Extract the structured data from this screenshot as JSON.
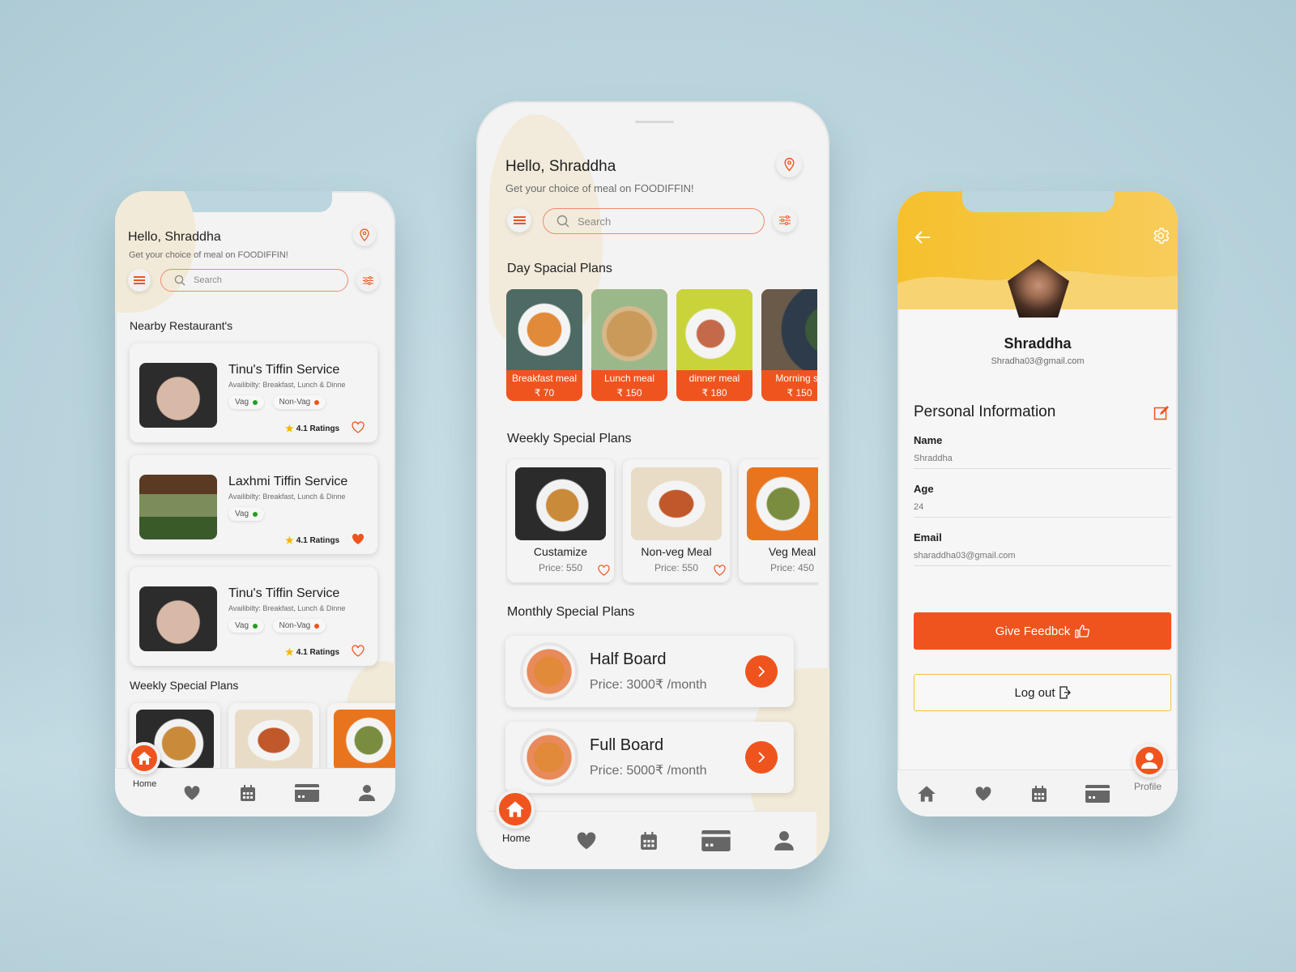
{
  "brand_colors": {
    "accent": "#f0541e",
    "accent_light": "#f08a6b",
    "yellow": "#f7c234",
    "veg": "#1ca31c",
    "nonveg": "#f0541e"
  },
  "left_phone": {
    "greeting": "Hello, Shraddha",
    "subtitle": "Get your choice of meal on FOODIFFIN!",
    "search_placeholder": "Search",
    "nearby_title": "Nearby Restaurant's",
    "restaurants": [
      {
        "name": "Tinu's Tiffin Service",
        "availability": "Availibilty: Breakfast, Lunch & Dinne",
        "tags": [
          "Vag",
          "Non-Vag"
        ],
        "rating": "4.1 Ratings",
        "favorited": false
      },
      {
        "name": "Laxhmi Tiffin Service",
        "availability": "Availibilty: Breakfast, Lunch & Dinne",
        "tags": [
          "Vag"
        ],
        "rating": "4.1 Ratings",
        "favorited": true
      },
      {
        "name": "Tinu's Tiffin Service",
        "availability": "Availibilty: Breakfast, Lunch & Dinne",
        "tags": [
          "Vag",
          "Non-Vag"
        ],
        "rating": "4.1 Ratings",
        "favorited": false
      }
    ],
    "weekly_title": "Weekly Special Plans",
    "nav": {
      "home": "Home"
    }
  },
  "center_phone": {
    "greeting": "Hello, Shraddha",
    "subtitle": "Get your choice of meal on FOODIFFIN!",
    "search_placeholder": "Search",
    "day_title": "Day Spacial Plans",
    "day_plans": [
      {
        "label": "Breakfast meal",
        "price": "₹ 70"
      },
      {
        "label": "Lunch meal",
        "price": "₹ 150"
      },
      {
        "label": "dinner meal",
        "price": "₹ 180"
      },
      {
        "label": "Morning sn",
        "price": "₹ 150"
      }
    ],
    "weekly_title": "Weekly Special Plans",
    "weekly_plans": [
      {
        "name": "Custamize",
        "price": "Price: 550"
      },
      {
        "name": "Non-veg Meal",
        "price": "Price: 550"
      },
      {
        "name": "Veg Meal",
        "price": "Price: 450"
      }
    ],
    "monthly_title": "Monthly Special Plans",
    "monthly_plans": [
      {
        "name": "Half Board",
        "price": "Price: 3000₹ /month"
      },
      {
        "name": "Full Board",
        "price": "Price: 5000₹ /month"
      }
    ],
    "nav": {
      "home": "Home"
    }
  },
  "right_phone": {
    "name": "Shraddha",
    "email": "Shradha03@gmail.com",
    "section_title": "Personal Information",
    "fields": [
      {
        "label": "Name",
        "value": "Shraddha"
      },
      {
        "label": "Age",
        "value": "24"
      },
      {
        "label": "Email",
        "value": "sharaddha03@gmail.com"
      }
    ],
    "feedback_label": "Give Feedbck",
    "logout_label": "Log out",
    "nav": {
      "profile": "Profile"
    }
  }
}
